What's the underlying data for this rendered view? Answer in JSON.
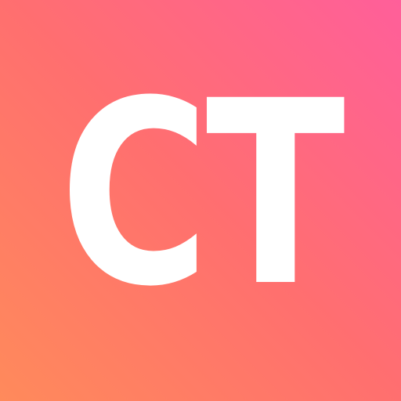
{
  "icon": {
    "monogram": "CT",
    "colors": {
      "gradient_start": "#FF8A5B",
      "gradient_mid": "#FF6F6F",
      "gradient_end": "#FF5F9A",
      "text": "#FFFFFF"
    }
  }
}
